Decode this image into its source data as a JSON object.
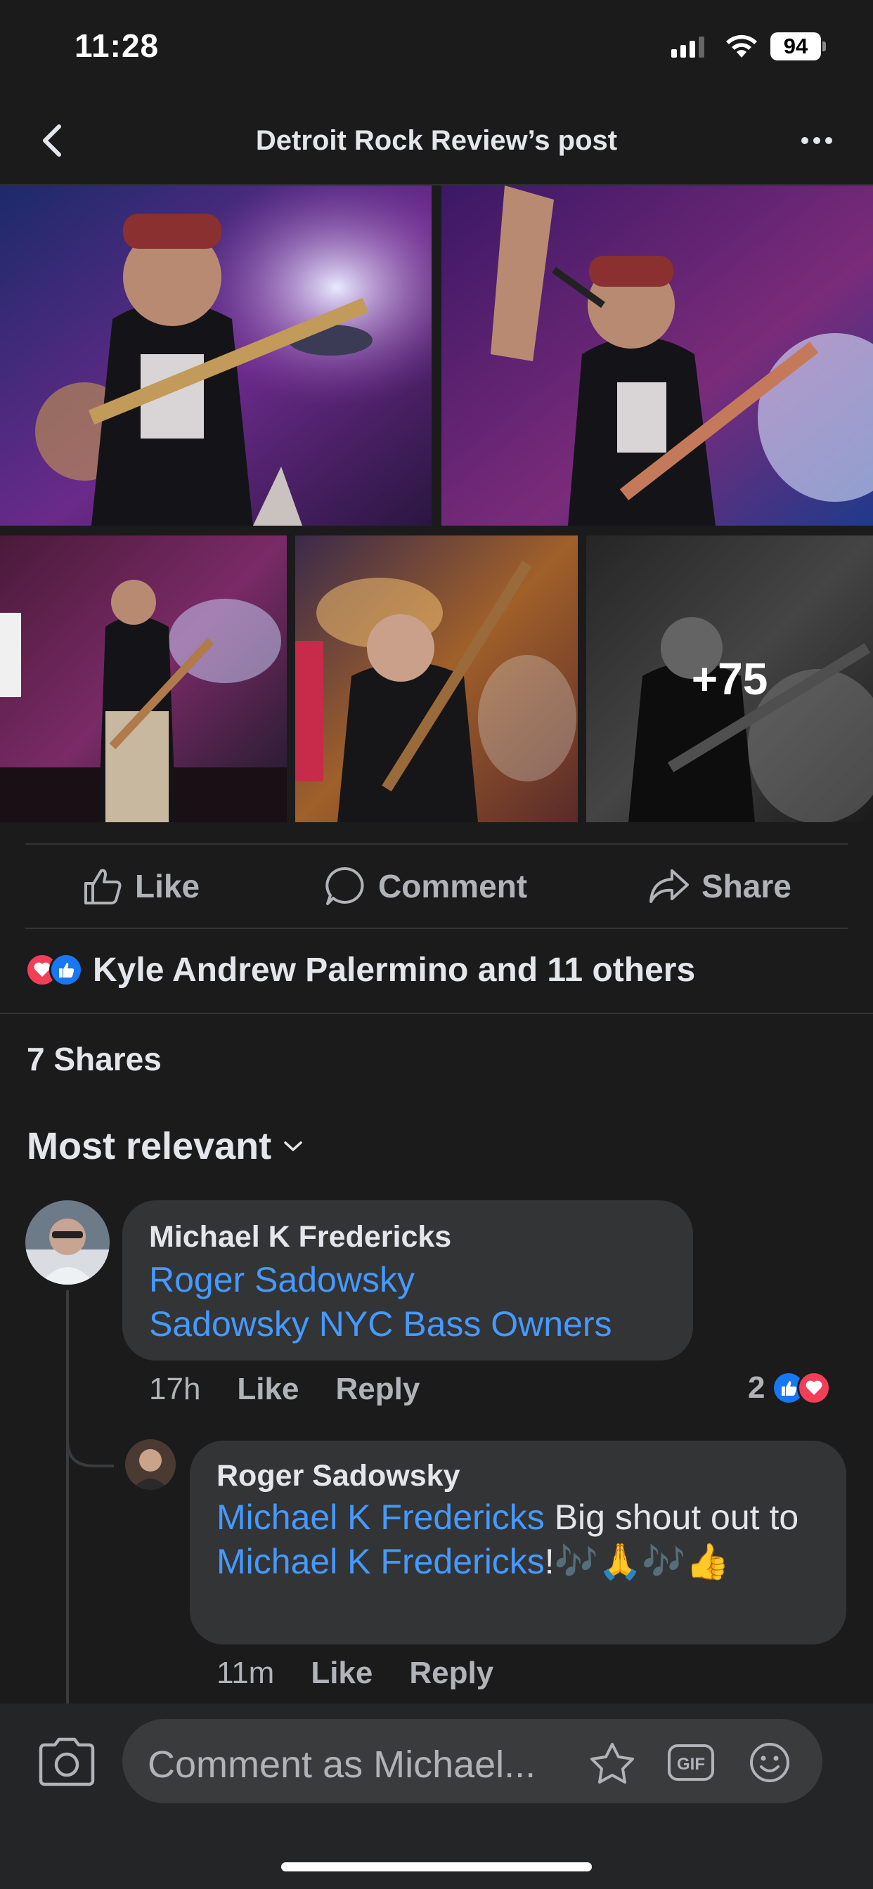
{
  "status_bar": {
    "time": "11:28",
    "battery": "94"
  },
  "nav": {
    "title": "Detroit Rock Review’s post"
  },
  "photos": {
    "more_count": "+75"
  },
  "actions": {
    "like": "Like",
    "comment": "Comment",
    "share": "Share"
  },
  "reactions": {
    "text": "Kyle Andrew Palermino and 11 others"
  },
  "shares": {
    "text": "7 Shares"
  },
  "sort": {
    "label": "Most relevant"
  },
  "comments": [
    {
      "author": "Michael K Fredericks",
      "tags": [
        "Roger Sadowsky",
        "Sadowsky NYC Bass Owners"
      ],
      "time": "17h",
      "like": "Like",
      "reply": "Reply",
      "reaction_count": "2"
    },
    {
      "author": "Roger Sadowsky",
      "mention": "Michael K Fredericks",
      "text_1": " Big shout out to ",
      "mention_2": "Michael K Fredericks",
      "text_2": "!🎶🙏🎶👍",
      "time": "11m",
      "like": "Like",
      "reply": "Reply"
    }
  ],
  "composer": {
    "placeholder": "Comment as Michael..."
  },
  "colors": {
    "link": "#4599ff",
    "like_blue": "#1877f2",
    "love_red": "#f33e58",
    "background": "#1b1b1c"
  }
}
